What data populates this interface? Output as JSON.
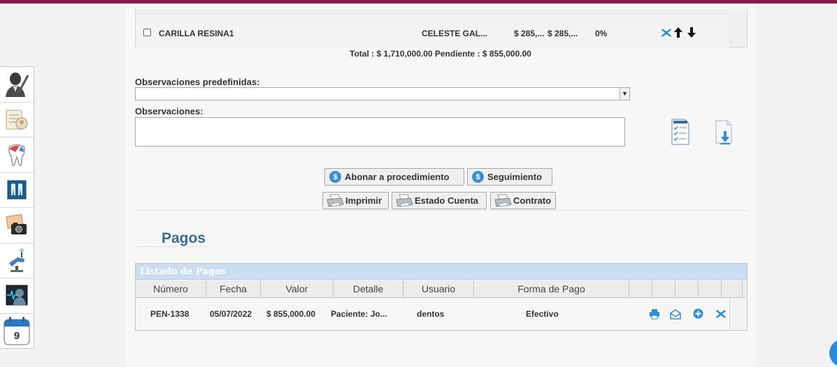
{
  "procedure_row": {
    "name": "CARILLA RESINA1",
    "doctor": "CELESTE GAL...",
    "value1": "$ 285,...",
    "value2": "$ 285,...",
    "discount": "0%"
  },
  "totals": {
    "text": "Total : $ 1,710,000.00   Pendiente : $ 855,000.00"
  },
  "observaciones_predefinidas": {
    "label": "Observaciones predefinidas:",
    "selected": ""
  },
  "observaciones": {
    "label": "Observaciones:",
    "value": ""
  },
  "buttons": {
    "abonar": "Abonar a procedimiento",
    "seguimiento": "Seguimiento",
    "imprimir": "Imprimir",
    "estado_cuenta": "Estado Cuenta",
    "contrato": "Contrato",
    "coin_symbol": "$"
  },
  "pagos": {
    "title": "Pagos",
    "caption": "Listado de Pagos",
    "columns": [
      "Número",
      "Fecha",
      "Valor",
      "Detalle",
      "Usuario",
      "Forma de Pago"
    ],
    "rows": [
      {
        "numero": "PEN-1338",
        "fecha": "05/07/2022",
        "valor": "$ 855,000.00",
        "detalle": "Paciente: Jo...",
        "usuario": "dentos",
        "forma_pago": "Efectivo"
      }
    ]
  },
  "calendar_day": "9",
  "colors": {
    "accent_bar": "#8b1a4a",
    "icon_blue": "#2f8fd6",
    "title_blue": "#3d6b97"
  },
  "sidebar_icons": [
    "doctor-icon",
    "clinical-record-icon",
    "tooth-icon",
    "dental-chart-icon",
    "camera-photo-icon",
    "dental-chair-icon",
    "xray-monitor-icon",
    "calendar-icon"
  ]
}
